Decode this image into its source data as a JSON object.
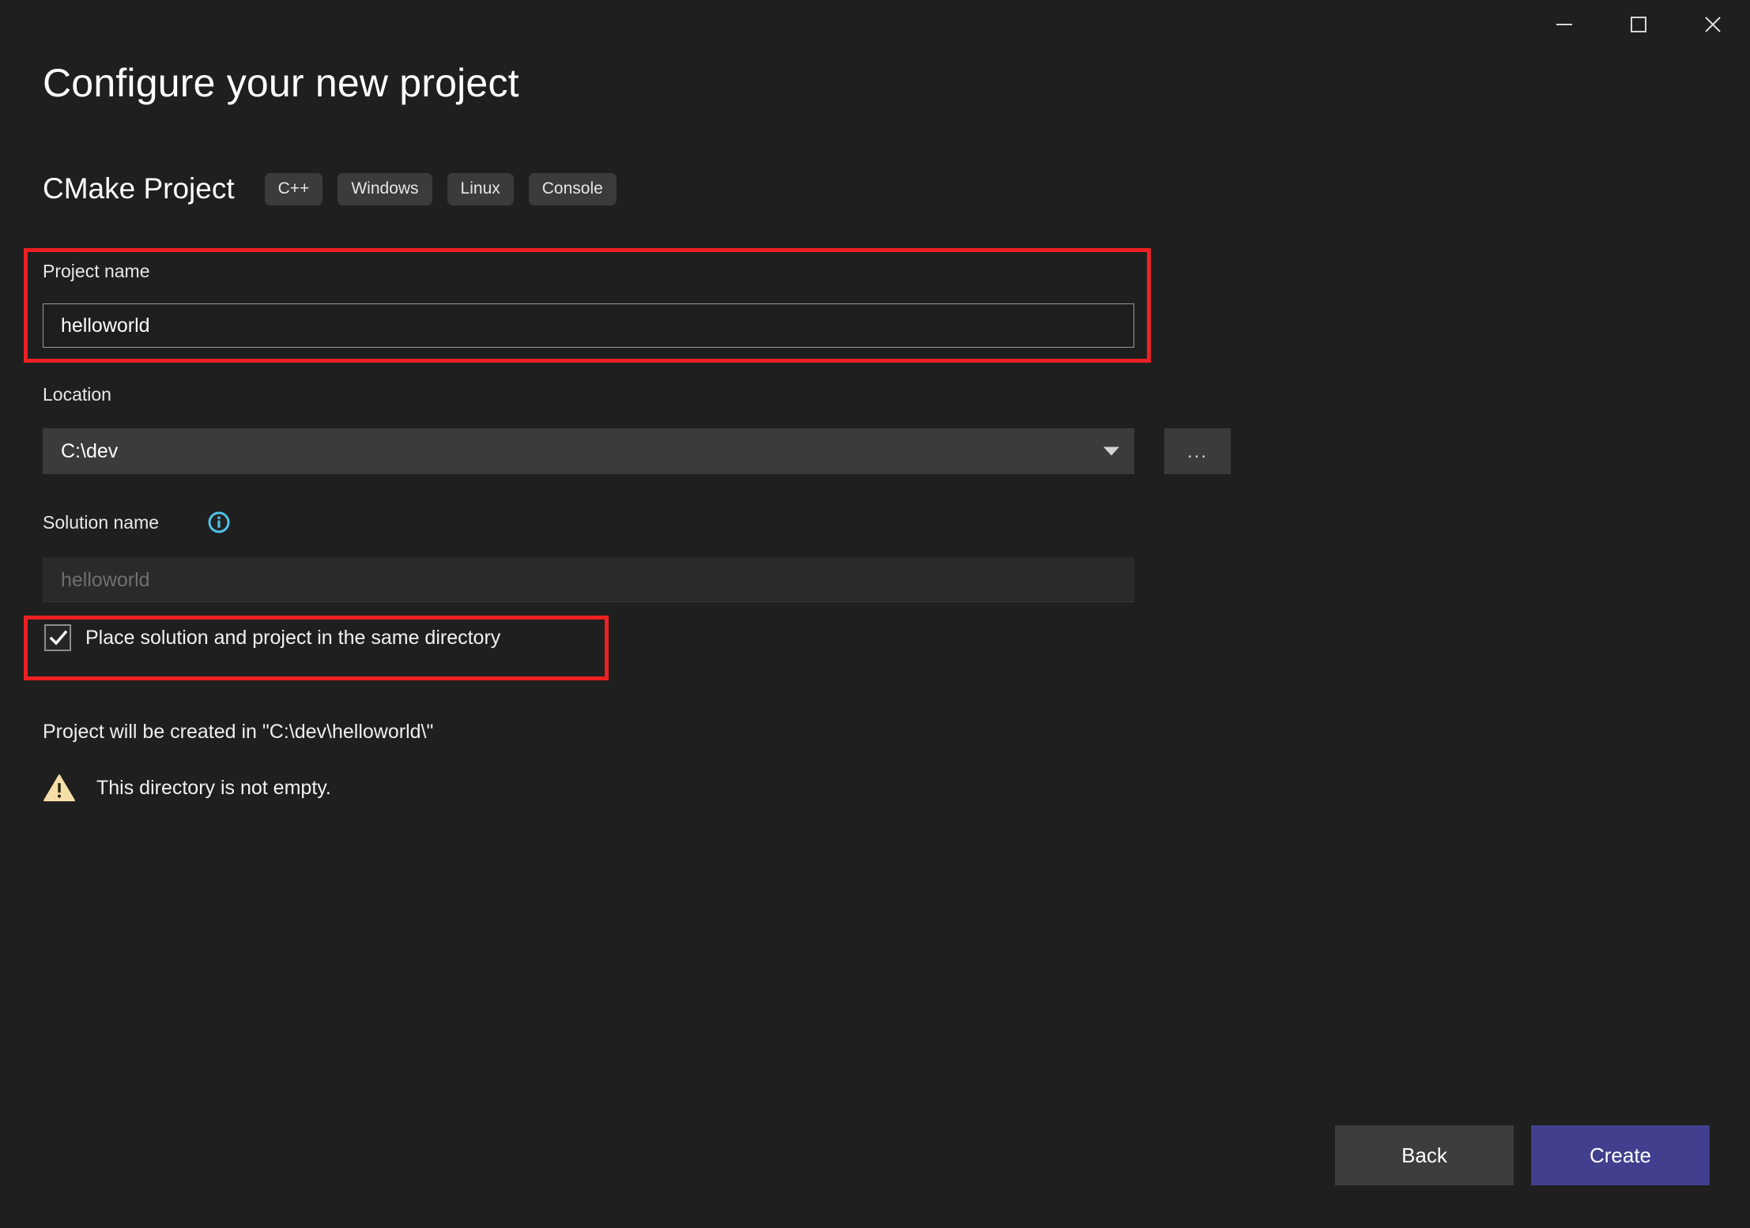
{
  "window": {
    "controls": [
      {
        "name": "minimize",
        "label": "Minimize"
      },
      {
        "name": "maximize",
        "label": "Maximize"
      },
      {
        "name": "close",
        "label": "Close"
      }
    ]
  },
  "header": {
    "title": "Configure your new project",
    "template_name": "CMake Project",
    "tags": [
      "C++",
      "Windows",
      "Linux",
      "Console"
    ]
  },
  "form": {
    "project_name": {
      "label": "Project name",
      "value": "helloworld"
    },
    "location": {
      "label": "Location",
      "value": "C:\\dev",
      "browse_label": "...",
      "dropdown_icon": "chevron-down-icon"
    },
    "solution_name": {
      "label": "Solution name",
      "info_icon": "info-icon",
      "placeholder": "helloworld",
      "value": ""
    },
    "same_directory": {
      "label": "Place solution and project in the same directory",
      "checked": true
    }
  },
  "status": {
    "path_message": "Project will be created in \"C:\\dev\\helloworld\\\"",
    "warning_icon": "warning-triangle-icon",
    "warning_message": "This directory is not empty."
  },
  "footer": {
    "back_label": "Back",
    "create_label": "Create"
  },
  "colors": {
    "background": "#1f1f1f",
    "accent_create": "#413f8e",
    "annotation": "#ed2024",
    "info": "#4fc3e8",
    "warning": "#f5dea8"
  }
}
